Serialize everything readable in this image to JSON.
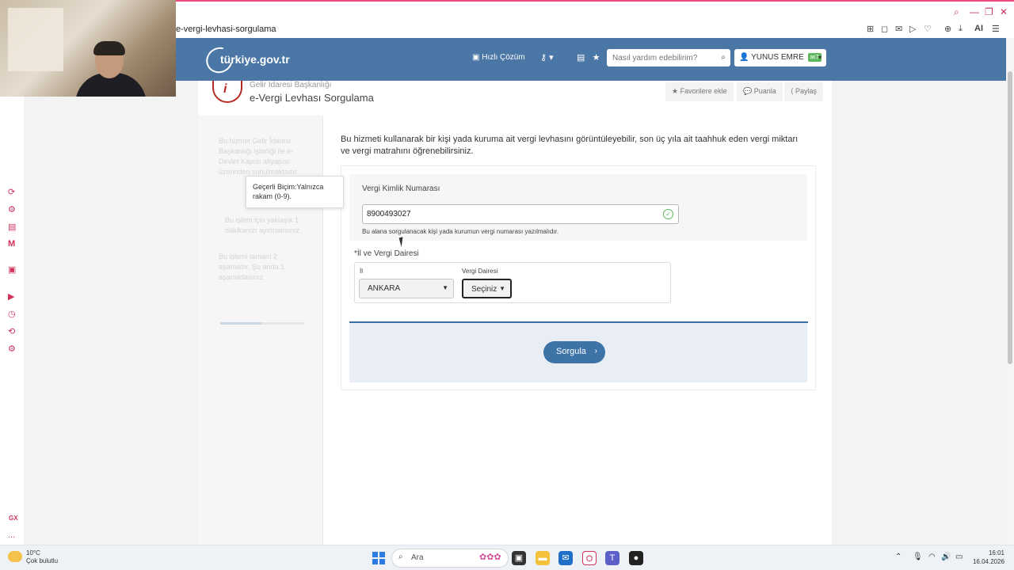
{
  "browser": {
    "url": "e-vergi-levhasi-sorgulama",
    "window_controls": [
      "⌕",
      "—",
      "❐",
      "✕"
    ],
    "extensions": [
      "⊞",
      "◻",
      "✉",
      "▷",
      "♡",
      "⊕",
      "⤓",
      "AI",
      "☰"
    ]
  },
  "opera_sidebar": [
    "⟳",
    "⚙",
    "▤",
    "M",
    "▣",
    "▶",
    "◷",
    "⟲",
    "⚙"
  ],
  "opera_bottom": [
    "GX",
    "..."
  ],
  "header": {
    "logo_text": "türkiye.gov.tr",
    "hizli_cozum": "Hızlı Çözüm",
    "search_placeholder": "Nasıl yardım edebilirim?",
    "user_name": "YUNUS EMRE",
    "user_badge": "7"
  },
  "page": {
    "org": "Gelir İdaresi Başkanlığı",
    "title": "e-Vergi Levhası Sorgulama",
    "actions": {
      "favorite": "Favorilere ekle",
      "rate": "Puanla",
      "share": "Paylaş"
    },
    "left_faded": [
      "Bu hizmet Gelir İdaresi Başkanlığı işbirliği ile e-Devlet Kapısı altyapısı üzerinden sunulmaktadır.",
      "Bu işlem için yaklaşık 1 dakikanızı ayırmalısınız.",
      "Bu işlemi tamam 2 aşamadır. Şu anda 1. aşamadasınız."
    ],
    "tooltip": "Geçerli Biçim:Yalnızca rakam (0-9).",
    "description": "Bu hizmeti kullanarak bir kişi yada kuruma ait vergi levhasını görüntüleyebilir, son üç yıla ait taahhuk eden vergi miktarı ve vergi matrahını öğrenebilirsiniz.",
    "form": {
      "vkn_label": "Vergi Kimlik Numarası",
      "vkn_value": "8900493027",
      "vkn_hint": "Bu alana sorgulanacak kişi yada kurumun vergi numarası yazılmalıdır.",
      "il_vd_label": "*İl ve Vergi Dairesi",
      "il_label": "İl",
      "il_value": "ANKARA",
      "vd_label": "Vergi Dairesi",
      "vd_value": "Seçiniz",
      "submit": "Sorgula"
    }
  },
  "taskbar": {
    "temp": "10°C",
    "weather": "Çok bulutlu",
    "search": "Ara",
    "time": "16:01",
    "date": "16.04.2026"
  }
}
